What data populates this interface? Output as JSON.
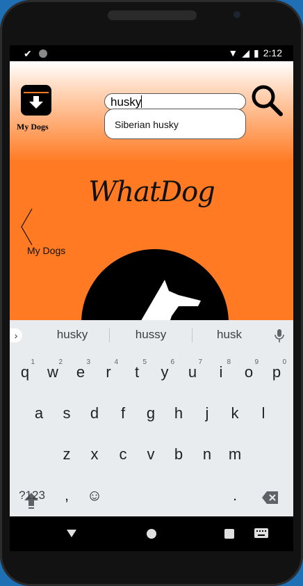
{
  "status_bar": {
    "left_icons": [
      "check-icon",
      "dot-icon"
    ],
    "time": "2:12",
    "right_icons": [
      "wifi-icon",
      "signal-icon",
      "battery-icon"
    ]
  },
  "app": {
    "my_dogs_label": "My Dogs",
    "search_value": "husky",
    "suggestion": "Siberian husky",
    "brand": "WhatDog",
    "back_label": "My Dogs",
    "accent_color": "#ff7a22"
  },
  "keyboard": {
    "suggestions": [
      "husky",
      "hussy",
      "husk"
    ],
    "row1": [
      {
        "k": "q",
        "n": "1"
      },
      {
        "k": "w",
        "n": "2"
      },
      {
        "k": "e",
        "n": "3"
      },
      {
        "k": "r",
        "n": "4"
      },
      {
        "k": "t",
        "n": "5"
      },
      {
        "k": "y",
        "n": "6"
      },
      {
        "k": "u",
        "n": "7"
      },
      {
        "k": "i",
        "n": "8"
      },
      {
        "k": "o",
        "n": "9"
      },
      {
        "k": "p",
        "n": "0"
      }
    ],
    "row2": [
      "a",
      "s",
      "d",
      "f",
      "g",
      "h",
      "j",
      "k",
      "l"
    ],
    "row3": [
      "z",
      "x",
      "c",
      "v",
      "b",
      "n",
      "m"
    ],
    "symbols_key": "?123",
    "comma_key": ",",
    "period_key": "."
  }
}
